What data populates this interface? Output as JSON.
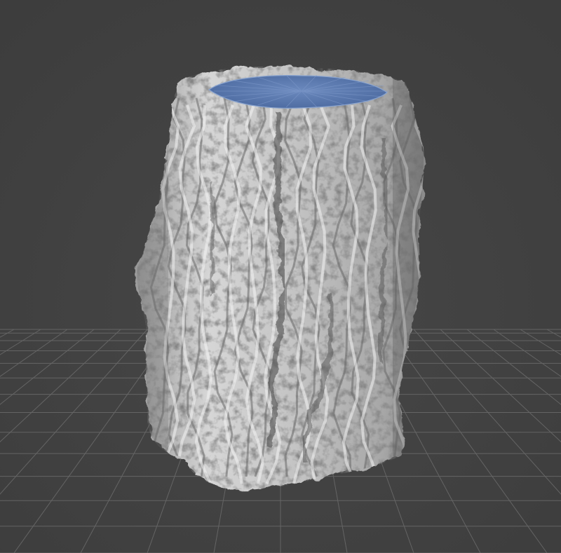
{
  "viewport": {
    "background_color": "#424242",
    "grid_color": "#6b6b6b",
    "grid_shown": true
  },
  "model": {
    "kind": "3D scanned tree-stump mesh",
    "surface_color": "#c9c9c9",
    "shadow_color": "#5e5e5e",
    "highlight_color": "#f2f2f2",
    "cap_color": "#5a79ad",
    "cap_edge_color": "#8aa4cf"
  }
}
